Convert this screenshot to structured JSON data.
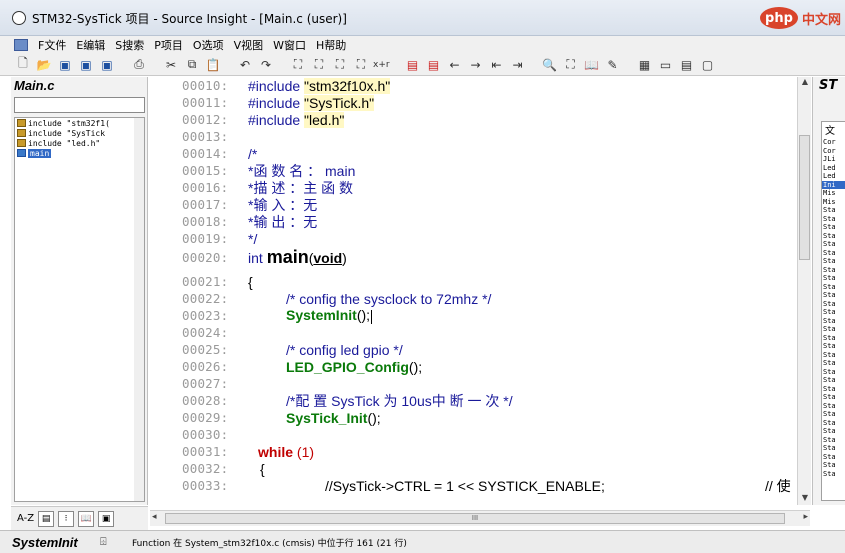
{
  "window": {
    "title": "STM32-SysTick 项目 - Source Insight - [Main.c (user)]",
    "watermark_logo": "php",
    "watermark_text": "中文网"
  },
  "menubar": {
    "items": [
      "F文件",
      "E编辑",
      "S搜索",
      "P项目",
      "O选项",
      "V视图",
      "W窗口",
      "H帮助"
    ]
  },
  "toolbar": {
    "find_label": "x+r"
  },
  "symbol_window": {
    "file_name": "Main.c",
    "filter_value": "",
    "symbols": [
      "include \"stm32f1(",
      "include \"SysTick",
      "include \"led.h\"",
      "main"
    ],
    "selected_index": 3
  },
  "editor": {
    "lines": [
      {
        "num": "00010:",
        "text": "#include \"stm32f10x.h\""
      },
      {
        "num": "00011:",
        "text": "#include \"SysTick.h\""
      },
      {
        "num": "00012:",
        "text": "#include \"led.h\""
      },
      {
        "num": "00013:",
        "text": ""
      },
      {
        "num": "00014:",
        "text": "/*"
      },
      {
        "num": "00015:",
        "text": " *函 数 名 ： main"
      },
      {
        "num": "00016:",
        "text": " *描  述 ：主 函 数"
      },
      {
        "num": "00017:",
        "text": " *输  入 ：无"
      },
      {
        "num": "00018:",
        "text": " *输  出 ：无"
      },
      {
        "num": "00019:",
        "text": " */"
      },
      {
        "num": "00020:",
        "text": "int main(void)"
      },
      {
        "num": "00021:",
        "text": "{"
      },
      {
        "num": "00022:",
        "text": "    /* config the sysclock to 72mhz */"
      },
      {
        "num": "00023:",
        "text": "    SystemInit();"
      },
      {
        "num": "00024:",
        "text": ""
      },
      {
        "num": "00025:",
        "text": "    /* config led gpio */"
      },
      {
        "num": "00026:",
        "text": "    LED_GPIO_Config();"
      },
      {
        "num": "00027:",
        "text": ""
      },
      {
        "num": "00028:",
        "text": "    /*配 置 SysTick 为 10us中 断 一 次 */"
      },
      {
        "num": "00029:",
        "text": "    SysTick_Init();"
      },
      {
        "num": "00030:",
        "text": ""
      },
      {
        "num": "00031:",
        "text": "  while (1)"
      },
      {
        "num": "00032:",
        "text": "  {"
      },
      {
        "num": "00033:",
        "text": "        //SysTick->CTRL = 1 << SYSTICK_ENABLE;      // 使"
      }
    ]
  },
  "right_panel": {
    "title": "ST",
    "top_label": "文",
    "items": [
      "Cor",
      "Cor",
      "JLi",
      "Led",
      "Led",
      "Ini",
      "Mis",
      "Mis",
      "Sta",
      "Sta",
      "Sta",
      "Sta",
      "Sta",
      "Sta",
      "Sta",
      "Sta",
      "Sta",
      "Sta",
      "Sta",
      "Sta",
      "Sta",
      "Sta",
      "Sta",
      "Sta",
      "Sta",
      "Sta",
      "Sta",
      "Sta",
      "Sta",
      "Sta",
      "Sta",
      "Sta",
      "Sta",
      "Sta",
      "Sta",
      "Sta",
      "Sta",
      "Sta",
      "Sta",
      "Sta"
    ],
    "selected_index": 5
  },
  "bottom_tools": {
    "az_label": "A-Z"
  },
  "hscroll": {
    "grip": "III"
  },
  "statusbar": {
    "symbol": "SystemInit",
    "message": "Function 在 System_stm32f10x.c (cmsis) 中位于行 161 (21 行)"
  }
}
